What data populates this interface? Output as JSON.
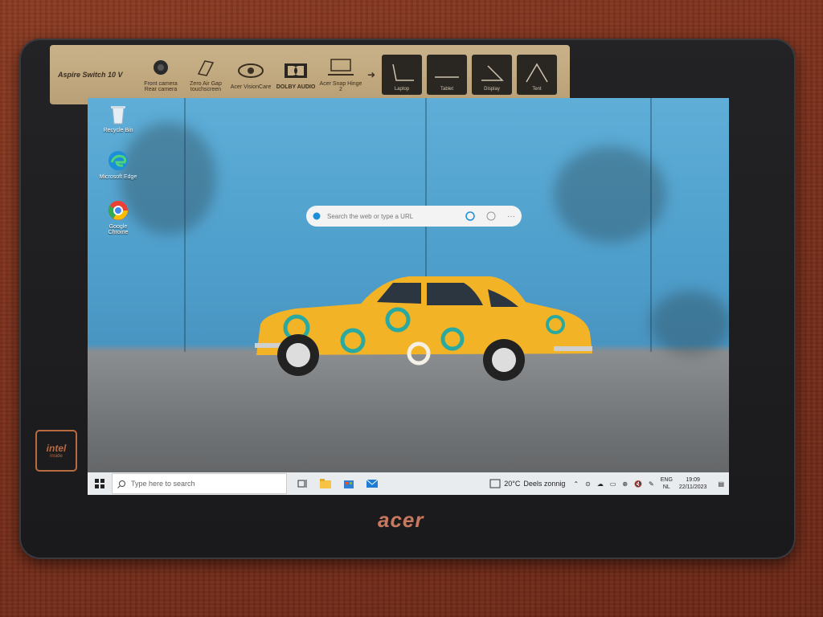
{
  "sticker": {
    "model": "Aspire Switch 10 V",
    "features": [
      {
        "icon": "camera-icon",
        "label": "Front camera\nRear camera"
      },
      {
        "icon": "touchscreen-icon",
        "label": "Zero Air Gap touchscreen"
      },
      {
        "icon": "eye-icon",
        "label": "Acer VisionCare"
      },
      {
        "icon": "dolby-icon",
        "label": "DOLBY AUDIO"
      },
      {
        "icon": "hinge-icon",
        "label": "Acer Snap Hinge 2"
      }
    ],
    "modes": [
      "Laptop",
      "Tablet",
      "Display",
      "Tent"
    ]
  },
  "desktop": {
    "icons": [
      {
        "label": "Recycle Bin",
        "icon": "recycle-bin-icon"
      },
      {
        "label": "Microsoft Edge",
        "icon": "edge-icon"
      },
      {
        "label": "Google Chrome",
        "icon": "chrome-icon"
      }
    ],
    "edge_search": {
      "placeholder": "Search the web or type a URL"
    }
  },
  "taskbar": {
    "search_placeholder": "Type here to search",
    "weather": {
      "temp": "20°C",
      "condition": "Deels zonnig"
    },
    "lang": {
      "line1": "ENG",
      "line2": "NL"
    },
    "clock": {
      "time": "19:09",
      "date": "22/11/2023"
    }
  },
  "bezel": {
    "brand": "acer",
    "intel_badge": "intel",
    "intel_sub": "inside"
  },
  "colors": {
    "wall": "#5eaed8",
    "car": "#f2b327",
    "taskbar": "#e9ecef",
    "bezel": "#1e1e20"
  }
}
